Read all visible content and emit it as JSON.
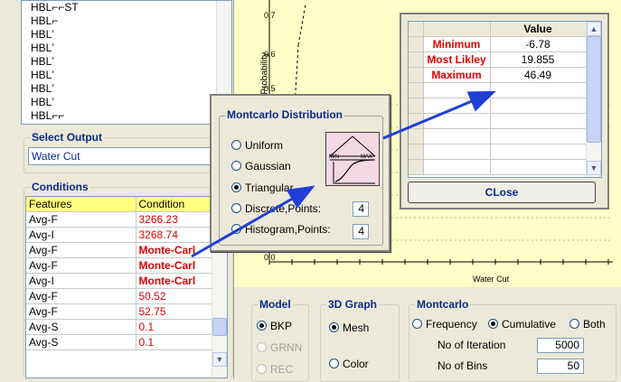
{
  "output_list": {
    "items": [
      "HBL⌐⌐ST",
      "HBL⌐",
      "HBLʼ",
      "HBLʼ",
      "HBLʼ",
      "HBLʼ",
      "HBLʼ",
      "HBLʼ",
      "HBL⌐⌐"
    ]
  },
  "select_output": {
    "label": "Select Output",
    "value": "Water Cut"
  },
  "conditions": {
    "label": "Conditions",
    "headers": [
      "Features",
      "Condition"
    ],
    "rows": [
      {
        "feature": "Avg-F",
        "condition": "3266.23"
      },
      {
        "feature": "Avg-I",
        "condition": "3268.74"
      },
      {
        "feature": "Avg-F",
        "condition": "Monte-Carl"
      },
      {
        "feature": "Avg-F",
        "condition": "Monte-Carl"
      },
      {
        "feature": "Avg-I",
        "condition": "Monte-Carl"
      },
      {
        "feature": "Avg-F",
        "condition": "50.52"
      },
      {
        "feature": "Avg-F",
        "condition": "52.75"
      },
      {
        "feature": "Avg-S",
        "condition": "0.1"
      },
      {
        "feature": "Avg-S",
        "condition": "0.1"
      }
    ]
  },
  "chart_data": {
    "type": "line",
    "ylabel": "e Probability",
    "xlabel": "Water Cut",
    "y_ticks": [
      "0.7",
      "0.6",
      "0.5",
      "0.0"
    ],
    "grid": true
  },
  "montecarlo_dist": {
    "title": "Montcarlo Distribution",
    "options": [
      "Uniform",
      "Gaussian",
      "Triangular",
      "Discrete,Points:",
      "Histogram,Points:"
    ],
    "selected": "Triangular",
    "discrete_points": "4",
    "histogram_points": "4",
    "triangle_icon": {
      "min_label": "MIN",
      "max_label": "MAX"
    }
  },
  "value_table": {
    "header": "Value",
    "rows": [
      {
        "label": "Minimum",
        "value": "-6.78"
      },
      {
        "label": "Most Likley",
        "value": "19.855"
      },
      {
        "label": "Maximum",
        "value": "46.49"
      }
    ],
    "close_label": "CLose"
  },
  "model": {
    "label": "Model",
    "options": [
      "BKP",
      "GRNN",
      "REC"
    ],
    "selected": "BKP"
  },
  "graph3d": {
    "label": "3D Graph",
    "options": [
      "Mesh",
      "Color"
    ],
    "selected": "Mesh"
  },
  "montecarlo": {
    "label": "Montcarlo",
    "options": [
      "Frequency",
      "Cumulative",
      "Both"
    ],
    "selected": "Cumulative",
    "iterations_label": "No of Iteration",
    "iterations_value": "5000",
    "bins_label": "No of Bins",
    "bins_value": "50"
  },
  "colors": {
    "accent_red": "#e00000",
    "header_yellow": "#ffff80",
    "group_blue": "#0b2a8c",
    "arrow_blue": "#1f3fd6"
  }
}
